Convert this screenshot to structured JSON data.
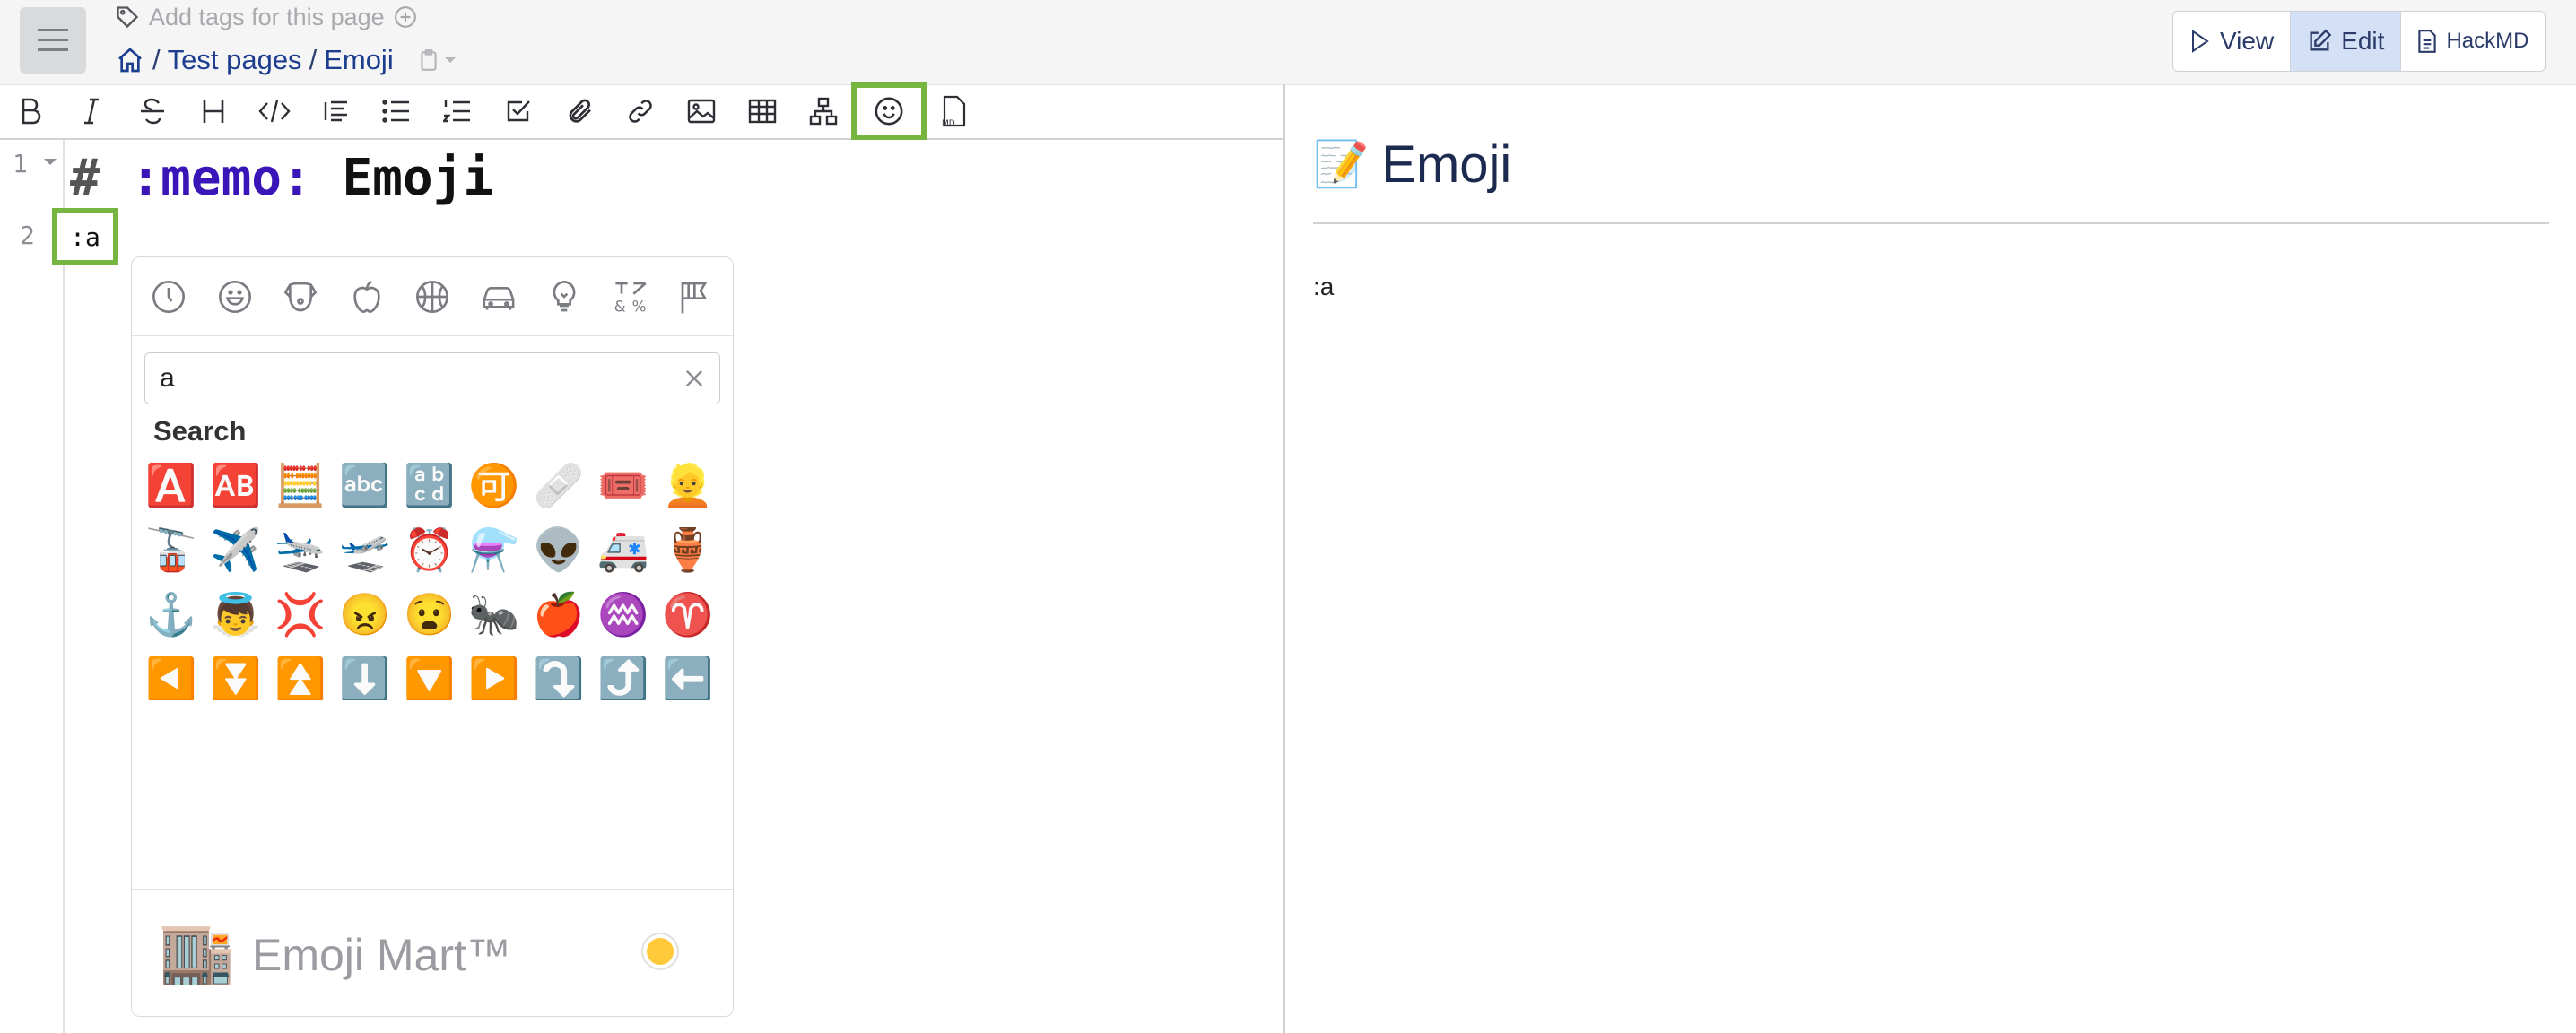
{
  "header": {
    "add_tags": "Add tags for this page",
    "breadcrumb": {
      "sep1": "/",
      "item1": "Test pages",
      "sep2": "/",
      "item2": "Emoji"
    }
  },
  "view_switch": {
    "view": "View",
    "edit": "Edit",
    "hackmd": "HackMD",
    "active": "edit"
  },
  "toolbar": {
    "items": [
      "bold",
      "italic",
      "strikethrough",
      "heading",
      "code",
      "blockquote",
      "bullet-list",
      "numbered-list",
      "checklist",
      "attachment",
      "link",
      "image",
      "table",
      "diagram",
      "emoji",
      "template"
    ],
    "highlighted": "emoji"
  },
  "editor": {
    "line_numbers": [
      "1",
      "2"
    ],
    "line1": {
      "hash": "#",
      "shortcode": ":memo:",
      "text": "Emoji"
    },
    "line2": ":a"
  },
  "preview": {
    "title_emoji": "📝",
    "title": "Emoji",
    "paragraph": ":a"
  },
  "emoji_picker": {
    "categories": [
      "recent-icon",
      "smileys-icon",
      "animals-icon",
      "food-icon",
      "activity-icon",
      "travel-icon",
      "objects-icon",
      "symbols-icon",
      "flags-icon"
    ],
    "search_value": "a",
    "section_label": "Search",
    "results": [
      "🅰️",
      "🆎",
      "🧮",
      "🔤",
      "🔡",
      "🉑",
      "🩹",
      "🎟️",
      "👱",
      "🚡",
      "✈️",
      "🛬",
      "🛫",
      "⏰",
      "⚗️",
      "👽",
      "🚑",
      "🏺",
      "⚓",
      "👼",
      "💢",
      "😠",
      "😧",
      "🐜",
      "🍎",
      "♒",
      "♈",
      "◀️",
      "⏬",
      "⏫",
      "⬇️",
      "🔽",
      "▶️",
      "⤵️",
      "⤴️",
      "⬅️",
      "↙️",
      "↘️",
      "➡️",
      "↪️",
      "⬆️",
      "↕️",
      "🔼",
      "↖️",
      "↗️",
      "🔃",
      "🔄",
      "🎨",
      "🚛",
      "🧑‍🎨",
      "😲",
      "🧑‍🚀",
      "👟",
      "🏧",
      "⚛️",
      "🛺",
      "🥑",
      "🪓",
      "👶",
      "🍼",
      "🐤",
      "🌅",
      "🔙"
    ],
    "footer_emoji": "🏬",
    "footer_title": "Emoji Mart™",
    "skin_tone_color": "#ffc93a"
  },
  "colors": {
    "highlight": "#76b53f",
    "link": "#1d3d8f",
    "active_tab": "#d4e0f5"
  }
}
